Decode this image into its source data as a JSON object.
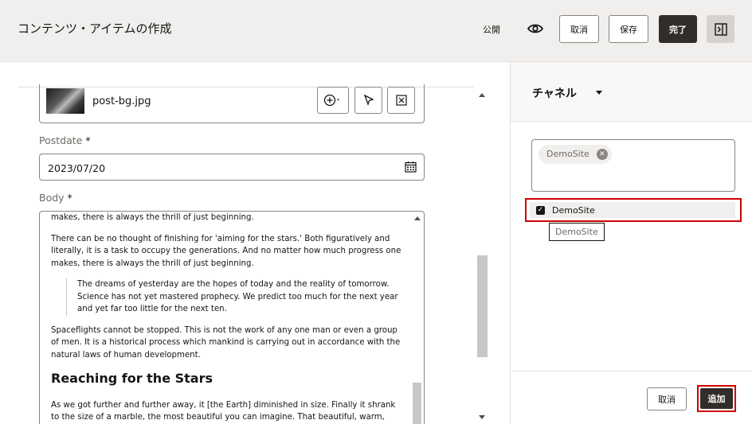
{
  "header": {
    "title": "コンテンツ・アイテムの作成",
    "publish_label": "公開",
    "cancel_label": "取消",
    "save_label": "保存",
    "done_label": "完了"
  },
  "form": {
    "asset": {
      "filename": "post-bg.jpg"
    },
    "postdate": {
      "label": "Postdate",
      "required_mark": "*",
      "value": "2023/07/20"
    },
    "body": {
      "label": "Body",
      "required_mark": "*",
      "p0": "makes, there is always the thrill of just beginning.",
      "p1": "There can be no thought of finishing for 'aiming for the stars.' Both figuratively and literally, it is a task to occupy the generations. And no matter how much progress one makes, there is always the thrill of just beginning.",
      "quote": "The dreams of yesterday are the hopes of today and the reality of tomorrow. Science has not yet mastered prophecy. We predict too much for the next year and yet far too little for the next ten.",
      "p2": "Spaceflights cannot be stopped. This is not the work of any one man or even a group of men. It is a historical process which mankind is carrying out in accordance with the natural laws of human development.",
      "heading": "Reaching for the Stars",
      "p3": "As we got further and further away, it [the Earth] diminished in size. Finally it shrank to the size of a marble, the most beautiful you can imagine. That beautiful, warm, living object"
    }
  },
  "panel": {
    "title": "チャネル",
    "selected_chip": "DemoSite",
    "option_label": "DemoSite",
    "tooltip": "DemoSite",
    "cancel_label": "取消",
    "add_label": "追加"
  }
}
